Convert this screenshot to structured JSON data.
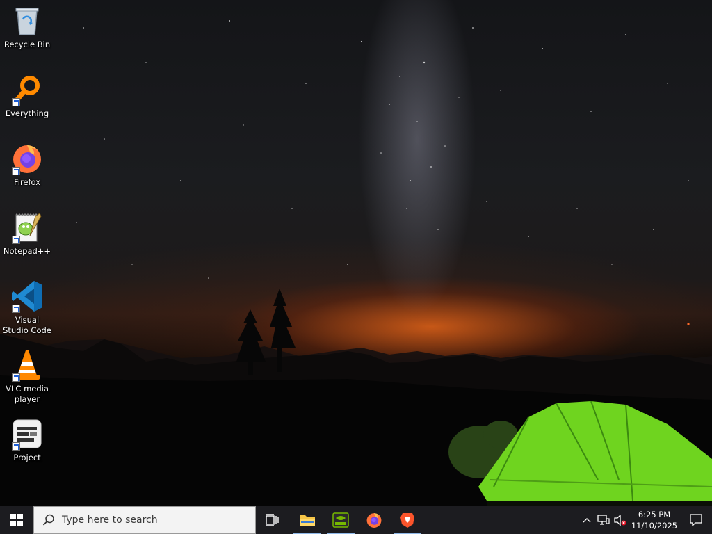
{
  "desktop": {
    "icons": [
      {
        "name": "recycle-bin",
        "label": "Recycle Bin",
        "icon": "recycle-bin-icon",
        "shortcut": false
      },
      {
        "name": "everything",
        "label": "Everything",
        "icon": "magnifier-icon",
        "shortcut": true
      },
      {
        "name": "firefox",
        "label": "Firefox",
        "icon": "firefox-icon",
        "shortcut": true
      },
      {
        "name": "notepad-plus-plus",
        "label": "Notepad++",
        "icon": "notepad-plus-plus-icon",
        "shortcut": true
      },
      {
        "name": "visual-studio-code",
        "label": "Visual Studio Code",
        "icon": "vscode-icon",
        "shortcut": true
      },
      {
        "name": "vlc-media-player",
        "label": "VLC media player",
        "icon": "vlc-cone-icon",
        "shortcut": true
      },
      {
        "name": "project",
        "label": "Project",
        "icon": "project-app-icon",
        "shortcut": true
      }
    ]
  },
  "taskbar": {
    "search_placeholder": "Type here to search",
    "pinned": [
      {
        "name": "task-view",
        "icon": "task-view-icon",
        "running": false
      },
      {
        "name": "file-explorer",
        "icon": "folder-icon",
        "running": true
      },
      {
        "name": "terminal-app",
        "icon": "terminal-app-icon",
        "running": true
      },
      {
        "name": "firefox",
        "icon": "firefox-icon",
        "running": false
      },
      {
        "name": "brave",
        "icon": "brave-lion-icon",
        "running": true
      }
    ],
    "tray": {
      "icons": [
        "chevron-up-icon",
        "network-icon",
        "speaker-muted-icon"
      ],
      "time": "6:25 PM",
      "date": "11/10/2025"
    }
  },
  "colors": {
    "taskbar_bg": "#1c1c20",
    "search_bg": "#f3f3f3",
    "tent_green": "#6fd41f",
    "horizon_glow": "#e06218"
  }
}
